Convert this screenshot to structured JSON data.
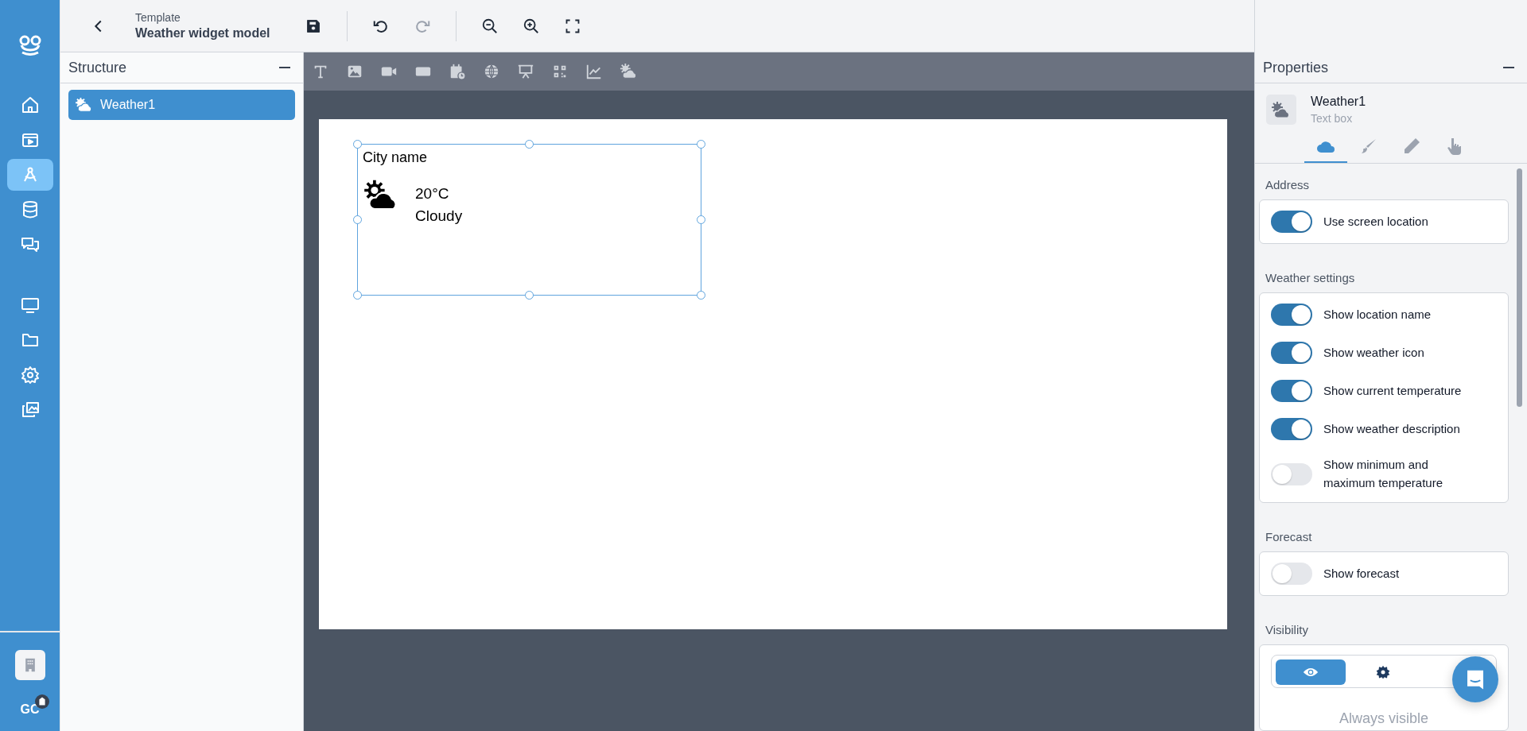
{
  "rail": {
    "items": [
      {
        "kind": "home",
        "selected": false
      },
      {
        "kind": "media",
        "selected": false
      },
      {
        "kind": "design",
        "selected": true
      },
      {
        "kind": "database",
        "selected": false
      },
      {
        "kind": "chat",
        "selected": false
      },
      {
        "kind": "screen",
        "selected": false
      },
      {
        "kind": "folder",
        "selected": false
      },
      {
        "kind": "settings",
        "selected": false
      },
      {
        "kind": "gallery",
        "selected": false
      }
    ],
    "avatar": "GC"
  },
  "header": {
    "subtitle": "Template",
    "title": "Weather widget model",
    "history": [
      {
        "kind": "undo",
        "disabled": false
      },
      {
        "kind": "redo",
        "disabled": true
      }
    ]
  },
  "structure": {
    "title": "Structure",
    "items": [
      {
        "label": "Weather1",
        "selected": true
      }
    ]
  },
  "canvas": {
    "tools": [
      {
        "kind": "text"
      },
      {
        "kind": "image"
      },
      {
        "kind": "video"
      },
      {
        "kind": "rect"
      },
      {
        "kind": "calendar"
      },
      {
        "kind": "web"
      },
      {
        "kind": "slides"
      },
      {
        "kind": "qr"
      },
      {
        "kind": "chart"
      },
      {
        "kind": "weather"
      }
    ],
    "widget": {
      "selected": true,
      "city": "City name",
      "temperature": "20°C",
      "description": "Cloudy"
    }
  },
  "properties": {
    "title": "Properties",
    "element_name": "Weather1",
    "element_type": "Text box",
    "tabs": [
      {
        "kind": "cloud",
        "selected": true
      },
      {
        "kind": "brush",
        "selected": false
      },
      {
        "kind": "pencil",
        "selected": false
      },
      {
        "kind": "hand",
        "selected": false
      }
    ],
    "sections": [
      {
        "title": "Address",
        "toggles": [
          {
            "label": "Use screen location",
            "on": true
          }
        ]
      },
      {
        "title": "Weather settings",
        "toggles": [
          {
            "label": "Show location name",
            "on": true
          },
          {
            "label": "Show weather icon",
            "on": true
          },
          {
            "label": "Show current temperature",
            "on": true
          },
          {
            "label": "Show weather description",
            "on": true
          },
          {
            "label": "Show minimum and maximum temperature",
            "on": false
          }
        ]
      },
      {
        "title": "Forecast",
        "toggles": [
          {
            "label": "Show forecast",
            "on": false
          }
        ]
      }
    ],
    "visibility": {
      "title": "Visibility",
      "options": [
        {
          "kind": "eye",
          "selected": true
        },
        {
          "kind": "gear",
          "selected": false
        }
      ],
      "caption": "Always visible"
    }
  }
}
